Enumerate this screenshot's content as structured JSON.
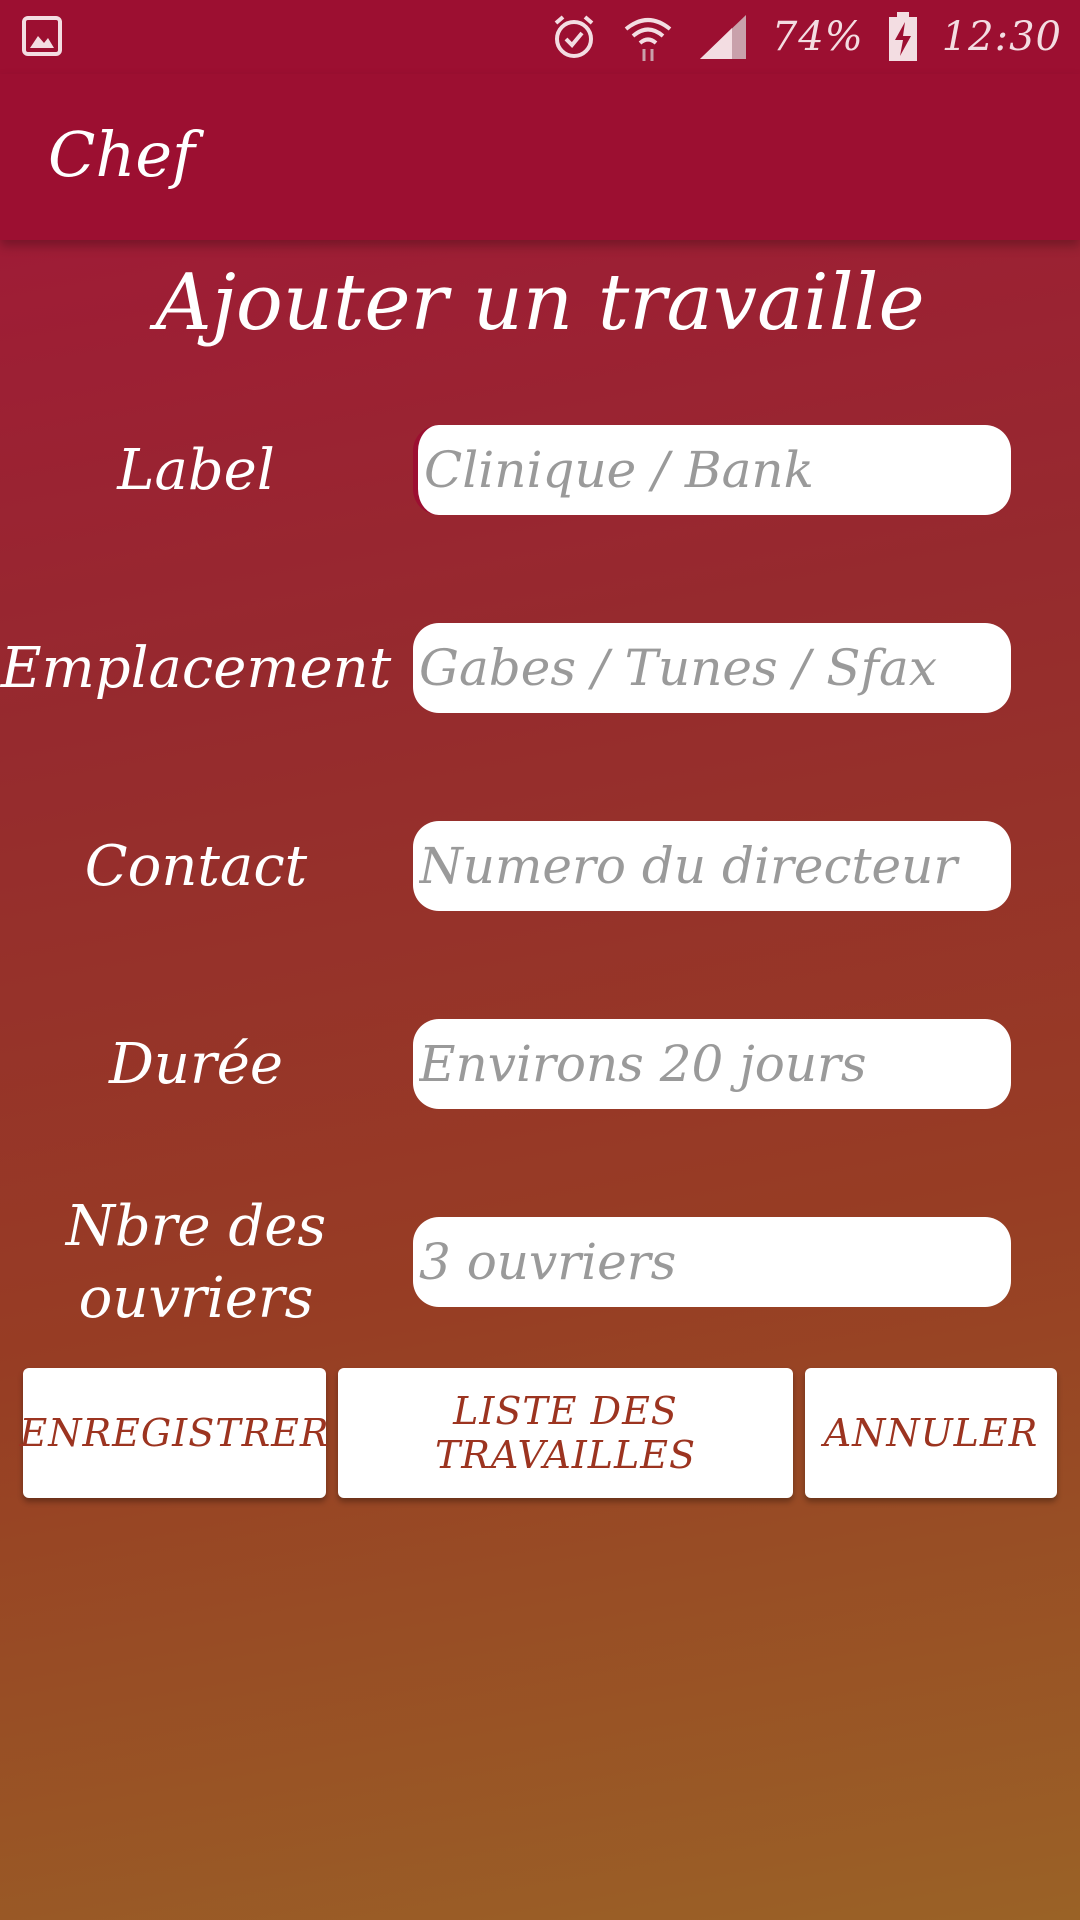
{
  "status_bar": {
    "battery": "74%",
    "time": "12:30",
    "icons": [
      "gallery-icon",
      "alarm-icon",
      "wifi-icon",
      "signal-icon",
      "battery-charging-icon"
    ]
  },
  "app_bar": {
    "title": "Chef"
  },
  "page": {
    "title": "Ajouter un travaille"
  },
  "form": {
    "label": {
      "label": "Label",
      "placeholder": "Clinique / Bank",
      "value": ""
    },
    "emplacement": {
      "label": "Emplacement",
      "placeholder": "Gabes / Tunes / Sfax",
      "value": ""
    },
    "contact": {
      "label": "Contact",
      "placeholder": "Numero du directeur",
      "value": ""
    },
    "duree": {
      "label": "Durée",
      "placeholder": "Environs 20 jours",
      "value": ""
    },
    "ouvriers": {
      "label_line1": "Nbre des",
      "label_line2": "ouvriers",
      "placeholder": "3 ouvriers",
      "value": ""
    }
  },
  "buttons": {
    "save": "ENREGISTRER",
    "list": "LISTE DES TRAVAILLES",
    "cancel": "ANNULER"
  },
  "colors": {
    "primary": "#9c0f31",
    "button_text": "#9c3420",
    "gradient_top": "#a3153a",
    "gradient_bottom": "#9a6226"
  }
}
